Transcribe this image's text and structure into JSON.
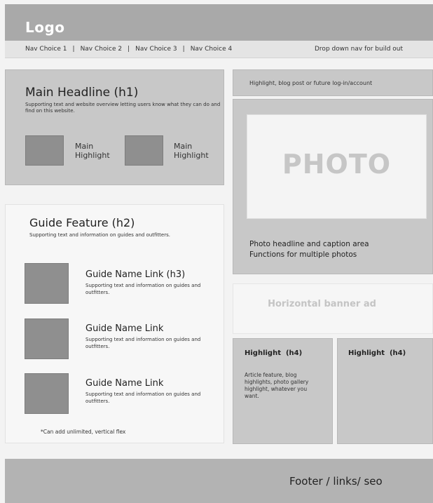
{
  "header": {
    "logo": "Logo"
  },
  "nav": {
    "items": [
      "Nav Choice 1",
      "Nav Choice 2",
      "Nav Choice 3",
      "Nav Choice 4"
    ],
    "separator": "|",
    "dropdown_note": "Drop down nav for build out"
  },
  "main": {
    "headline": "Main Headline (h1)",
    "support": "Supporting text and website overview letting users know what they can do and find on this website.",
    "highlights": [
      "Main\nHighlight",
      "Main\nHighlight"
    ]
  },
  "guide": {
    "heading": "Guide Feature (h2)",
    "support": "Supporting text and information on guides and outfitters.",
    "items": [
      {
        "title": "Guide Name Link (h3)",
        "text": "Supporting text and information on guides and outfitters."
      },
      {
        "title": "Guide Name Link",
        "text": "Supporting text and information on guides and outfitters."
      },
      {
        "title": "Guide Name Link",
        "text": "Supporting text and information on guides and outfitters."
      }
    ],
    "note": "*Can add unlimited, vertical flex"
  },
  "sidebar": {
    "top_highlight": "Highlight, blog post or future log-in/account",
    "photo_word": "PHOTO",
    "photo_caption": "Photo headline and caption area\nFunctions for multiple photos",
    "banner": "Horizontal banner ad",
    "h4_boxes": [
      {
        "title": "Highlight  (h4)",
        "text": "Article feature, blog highlights, photo gallery highlight, whatever you want."
      },
      {
        "title": "Highlight  (h4)",
        "text": ""
      }
    ]
  },
  "footer": {
    "text": "Footer / links/ seo"
  }
}
